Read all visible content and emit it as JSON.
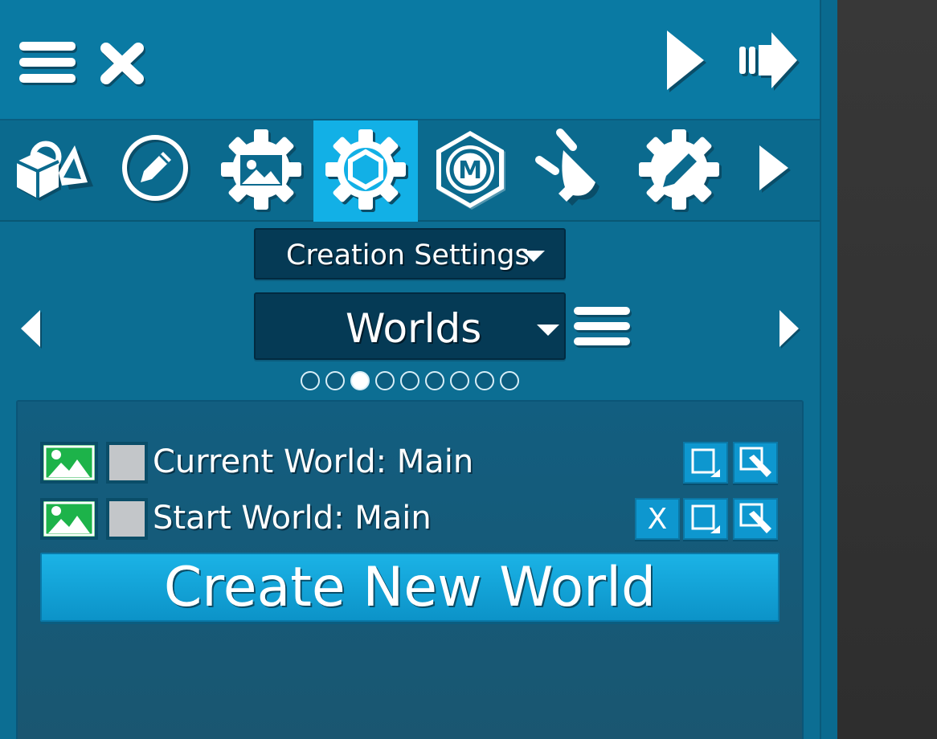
{
  "toolbar": {
    "menu_icon": "hamburger-menu-icon",
    "close_icon": "close-x-icon",
    "play_icon": "play-icon",
    "skip_icon": "fast-forward-arrow-icon"
  },
  "tool_icons": [
    {
      "icon": "shapes-objects-icon",
      "active": false
    },
    {
      "icon": "pencil-circle-icon",
      "active": false
    },
    {
      "icon": "gear-image-icon",
      "active": false
    },
    {
      "icon": "gear-hexagon-icon",
      "active": true
    },
    {
      "icon": "hexagon-m-icon",
      "active": false
    },
    {
      "icon": "plug-icon",
      "active": false
    },
    {
      "icon": "gear-pencil-icon",
      "active": false
    },
    {
      "icon": "next-arrow-icon",
      "active": false
    }
  ],
  "settings_dropdown": {
    "label": "Creation Settings"
  },
  "category_dropdown": {
    "label": "Worlds"
  },
  "pagination": {
    "total": 9,
    "current": 3
  },
  "worlds": [
    {
      "label": "Current World: Main",
      "show_delete": false,
      "delete_label": ""
    },
    {
      "label": "Start World: Main",
      "show_delete": true,
      "delete_label": "X"
    }
  ],
  "create_button": {
    "label": "Create New World"
  },
  "colors": {
    "panel": "#0c6e93",
    "active_tab": "#12b0e6",
    "dropdown": "#053a55",
    "image_green": "#1db34a"
  }
}
